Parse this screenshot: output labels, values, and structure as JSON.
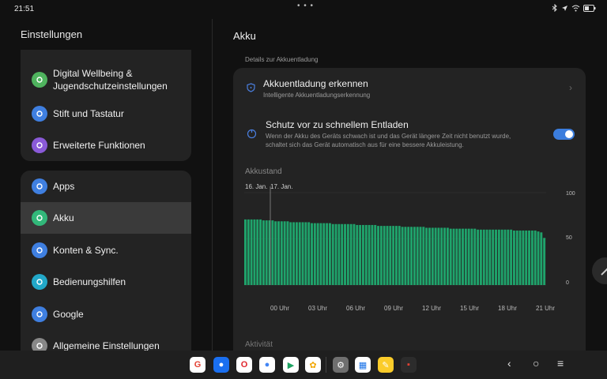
{
  "status": {
    "time": "21:51"
  },
  "left": {
    "title": "Einstellungen",
    "group1": [
      {
        "label": "Digital Wellbeing & Jugendschutzeinstellungen",
        "icon": "digital-wellbeing-icon",
        "color": "#4fb35e"
      },
      {
        "label": "Stift und Tastatur",
        "icon": "pen-icon",
        "color": "#3f7fe0"
      },
      {
        "label": "Erweiterte Funktionen",
        "icon": "extended-functions-icon",
        "color": "#8a5ad8"
      }
    ],
    "group2": [
      {
        "label": "Apps",
        "icon": "apps-icon",
        "color": "#3f7fe0"
      },
      {
        "label": "Akku",
        "icon": "battery-icon",
        "color": "#32b87a",
        "selected": true
      },
      {
        "label": "Konten & Sync.",
        "icon": "accounts-icon",
        "color": "#3f7fe0"
      },
      {
        "label": "Bedienungshilfen",
        "icon": "accessibility-icon",
        "color": "#22a8c8"
      },
      {
        "label": "Google",
        "icon": "google-icon",
        "color": "#3f7fe0"
      },
      {
        "label": "Allgemeine Einstellungen",
        "icon": "general-settings-icon",
        "color": "#888888"
      }
    ]
  },
  "right": {
    "title": "Akku",
    "section_caption": "Details zur Akkuentladung",
    "detect": {
      "title": "Akkuentladung erkennen",
      "subtitle": "Intelligente Akkuentladungserkennung"
    },
    "protect": {
      "title": "Schutz vor zu schnellem Entladen",
      "subtitle_line1": "Wenn der Akku des Geräts schwach ist und das Gerät längere Zeit nicht benutzt wurde,",
      "subtitle_line2": "schaltet sich das Gerät automatisch aus für eine bessere Akkuleistung.",
      "enabled": true
    },
    "chart_title": "Akkustand",
    "activity_label": "Aktivität"
  },
  "chart_data": {
    "type": "bar",
    "title": "Akkustand",
    "date_labels": [
      "16. Jan.",
      "17. Jan."
    ],
    "x_ticks": [
      "00 Uhr",
      "03 Uhr",
      "06 Uhr",
      "09 Uhr",
      "12 Uhr",
      "15 Uhr",
      "18 Uhr",
      "21 Uhr"
    ],
    "y_ticks": [
      "100",
      "50",
      "0"
    ],
    "ylim": [
      0,
      100
    ],
    "color": "#1fa36b",
    "values": [
      71,
      71,
      71,
      71,
      71,
      71,
      70,
      70,
      70,
      70,
      69,
      69,
      69,
      69,
      69,
      68,
      68,
      68,
      68,
      68,
      68,
      68,
      67,
      67,
      67,
      67,
      67,
      67,
      67,
      66,
      66,
      66,
      66,
      66,
      66,
      66,
      66,
      65,
      65,
      65,
      65,
      65,
      65,
      65,
      64,
      64,
      64,
      64,
      64,
      64,
      64,
      64,
      63,
      63,
      63,
      63,
      63,
      63,
      63,
      63,
      62,
      62,
      62,
      62,
      62,
      62,
      62,
      62,
      61,
      61,
      61,
      61,
      61,
      61,
      61,
      61,
      61,
      60,
      60,
      60,
      60,
      60,
      60,
      60,
      60,
      60,
      60,
      60,
      60,
      59,
      59,
      59,
      59,
      59,
      59,
      59,
      59,
      58,
      57,
      51
    ]
  },
  "taskbar": {
    "apps": [
      {
        "name": "chrome-app-icon",
        "glyph": "G",
        "color": "#ffffff",
        "fg": "#e34133"
      },
      {
        "name": "messages-app-icon",
        "glyph": "●",
        "color": "#1a6ff0",
        "fg": "#ffffff"
      },
      {
        "name": "opera-app-icon",
        "glyph": "O",
        "color": "#ffffff",
        "fg": "#e0262e"
      },
      {
        "name": "assistant-app-icon",
        "glyph": "●",
        "color": "#ffffff",
        "fg": "#4285f4"
      },
      {
        "name": "play-store-app-icon",
        "glyph": "▶",
        "color": "#ffffff",
        "fg": "#1ea362"
      },
      {
        "name": "photos-app-icon",
        "glyph": "✿",
        "color": "#ffffff",
        "fg": "#f2a600"
      },
      {
        "name": "settings-app-icon",
        "glyph": "⚙",
        "color": "#6f6f6f",
        "fg": "#ffffff"
      },
      {
        "name": "calendar-app-icon",
        "glyph": "▦",
        "color": "#ffffff",
        "fg": "#1a73e8"
      },
      {
        "name": "notes-app-icon",
        "glyph": "✎",
        "color": "#fbcc2a",
        "fg": "#ffffff"
      },
      {
        "name": "app-library-icon",
        "glyph": "▪",
        "color": "#2c2c2c",
        "fg": "#e34133"
      }
    ]
  }
}
